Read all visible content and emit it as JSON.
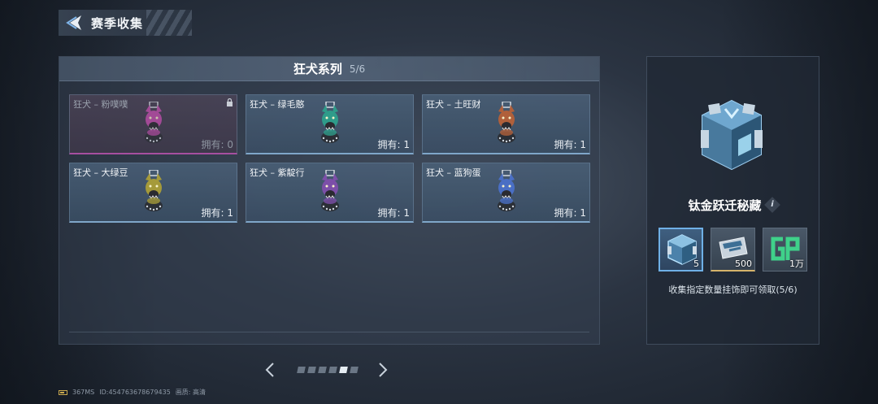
{
  "header": {
    "title": "赛季收集",
    "back_icon": "back-arrow-icon"
  },
  "panel": {
    "title": "狂犬系列",
    "count": "5/6",
    "cards": [
      {
        "name": "狂犬 – 粉噗噗",
        "owned": "拥有: 0",
        "locked": true,
        "color": "#c24fae"
      },
      {
        "name": "狂犬 – 绿毛憨",
        "owned": "拥有: 1",
        "locked": false,
        "color": "#2f9c8a"
      },
      {
        "name": "狂犬 – 土旺财",
        "owned": "拥有: 1",
        "locked": false,
        "color": "#b0603b"
      },
      {
        "name": "狂犬 – 大绿豆",
        "owned": "拥有: 1",
        "locked": false,
        "color": "#a59a3a"
      },
      {
        "name": "狂犬 – 紫靛行",
        "owned": "拥有: 1",
        "locked": false,
        "color": "#7c4fa8"
      },
      {
        "name": "狂犬 – 蓝狗蛋",
        "owned": "拥有: 1",
        "locked": false,
        "color": "#4a6fc4"
      }
    ]
  },
  "pager": {
    "pages": 6,
    "active": 5
  },
  "reward": {
    "title": "钛金跃迁秘藏",
    "info_icon": "i",
    "items": [
      {
        "icon": "titanium-chest-icon",
        "qty": "5"
      },
      {
        "icon": "ticket-icon",
        "qty": "500"
      },
      {
        "icon": "gp-currency-icon",
        "qty": "1万"
      }
    ],
    "desc": "收集指定数量挂饰即可领取(5/6)"
  },
  "status": {
    "ping": "367MS",
    "id": "ID:454763678679435",
    "quality": "画质: 高清"
  }
}
